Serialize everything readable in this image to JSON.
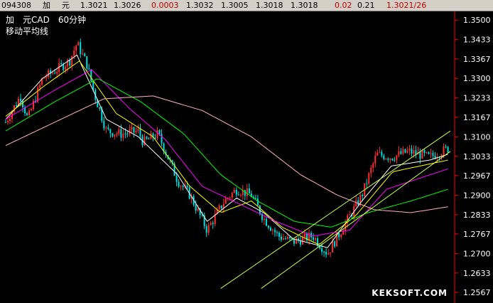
{
  "quote_bar": {
    "code": "094308",
    "name_1": "加",
    "name_2": "元",
    "open": "1.3021",
    "prev": "1.3026",
    "change": "0.0003",
    "high": "1.3032",
    "low": "1.3005",
    "last": "1.3018",
    "last2": "1.3018",
    "pct": "0.02",
    "vol": "0.21",
    "bid_ask": "1.3021/26"
  },
  "header": {
    "symbol_line": "加　元CAD　60分钟",
    "indicator": "移动平均线"
  },
  "watermark": "KEKSOFT.COM",
  "colors": {
    "background": "#000000",
    "axis": "#ff0000",
    "up_candle": "#ff3030",
    "down_candle": "#00e0e0",
    "ma5": "#ffffff",
    "ma10": "#ffff00",
    "ma20": "#ff00ff",
    "ma30": "#00ff00",
    "ma60": "#ffb0c8",
    "channel": "#c8ff50",
    "topbar_bg": "#d4d0c8"
  },
  "chart_data": {
    "type": "line",
    "title": "加　元CAD　60分钟",
    "subtitle": "移动平均线",
    "y_ticks": [
      "1.3500",
      "1.3433",
      "1.3367",
      "1.3300",
      "1.3233",
      "1.3167",
      "1.3100",
      "1.3033",
      "1.2967",
      "1.2900",
      "1.2833",
      "1.2767",
      "1.2700",
      "1.2633",
      "1.2567"
    ],
    "ylim": [
      1.254,
      1.352
    ],
    "x_count": 208,
    "price_path": [
      [
        0,
        1.315
      ],
      [
        12,
        1.324
      ],
      [
        18,
        1.316
      ],
      [
        30,
        1.33
      ],
      [
        38,
        1.332
      ],
      [
        52,
        1.336
      ],
      [
        58,
        1.342
      ],
      [
        66,
        1.335
      ],
      [
        72,
        1.325
      ],
      [
        82,
        1.312
      ],
      [
        94,
        1.311
      ],
      [
        108,
        1.312
      ],
      [
        112,
        1.308
      ],
      [
        124,
        1.311
      ],
      [
        140,
        1.295
      ],
      [
        150,
        1.29
      ],
      [
        164,
        1.278
      ],
      [
        178,
        1.288
      ],
      [
        188,
        1.292
      ],
      [
        200,
        1.29
      ],
      [
        210,
        1.282
      ],
      [
        222,
        1.276
      ],
      [
        234,
        1.274
      ],
      [
        250,
        1.276
      ],
      [
        262,
        1.27
      ],
      [
        272,
        1.277
      ],
      [
        290,
        1.29
      ],
      [
        302,
        1.304
      ],
      [
        314,
        1.303
      ],
      [
        328,
        1.305
      ],
      [
        345,
        1.303
      ],
      [
        360,
        1.306
      ]
    ],
    "moving_averages": [
      {
        "name": "MA5",
        "color": "#ffffff",
        "values": [
          [
            0,
            1.316
          ],
          [
            30,
            1.33
          ],
          [
            58,
            1.338
          ],
          [
            82,
            1.316
          ],
          [
            108,
            1.31
          ],
          [
            140,
            1.297
          ],
          [
            164,
            1.281
          ],
          [
            188,
            1.289
          ],
          [
            210,
            1.284
          ],
          [
            234,
            1.275
          ],
          [
            262,
            1.272
          ],
          [
            290,
            1.288
          ],
          [
            314,
            1.3
          ],
          [
            345,
            1.302
          ],
          [
            360,
            1.304
          ]
        ]
      },
      {
        "name": "MA10",
        "color": "#ffff00",
        "values": [
          [
            0,
            1.317
          ],
          [
            30,
            1.327
          ],
          [
            60,
            1.336
          ],
          [
            90,
            1.318
          ],
          [
            120,
            1.31
          ],
          [
            150,
            1.293
          ],
          [
            175,
            1.284
          ],
          [
            200,
            1.288
          ],
          [
            225,
            1.279
          ],
          [
            255,
            1.273
          ],
          [
            285,
            1.283
          ],
          [
            315,
            1.298
          ],
          [
            360,
            1.302
          ]
        ]
      },
      {
        "name": "MA20",
        "color": "#ff00ff",
        "values": [
          [
            0,
            1.316
          ],
          [
            40,
            1.326
          ],
          [
            70,
            1.333
          ],
          [
            100,
            1.32
          ],
          [
            130,
            1.309
          ],
          [
            160,
            1.293
          ],
          [
            190,
            1.287
          ],
          [
            220,
            1.281
          ],
          [
            250,
            1.276
          ],
          [
            280,
            1.278
          ],
          [
            310,
            1.292
          ],
          [
            360,
            1.299
          ]
        ]
      },
      {
        "name": "MA30",
        "color": "#00ff00",
        "values": [
          [
            0,
            1.312
          ],
          [
            40,
            1.322
          ],
          [
            75,
            1.33
          ],
          [
            110,
            1.322
          ],
          [
            145,
            1.311
          ],
          [
            175,
            1.297
          ],
          [
            205,
            1.288
          ],
          [
            235,
            1.281
          ],
          [
            265,
            1.279
          ],
          [
            295,
            1.284
          ],
          [
            330,
            1.288
          ],
          [
            360,
            1.292
          ]
        ]
      },
      {
        "name": "MA60",
        "color": "#ffb0c8",
        "values": [
          [
            0,
            1.307
          ],
          [
            40,
            1.315
          ],
          [
            80,
            1.323
          ],
          [
            120,
            1.324
          ],
          [
            160,
            1.319
          ],
          [
            200,
            1.31
          ],
          [
            240,
            1.297
          ],
          [
            270,
            1.29
          ],
          [
            300,
            1.285
          ],
          [
            330,
            1.284
          ],
          [
            360,
            1.286
          ]
        ]
      }
    ],
    "channel_lines": [
      {
        "from": [
          175,
          1.258
        ],
        "to": [
          362,
          1.312
        ]
      },
      {
        "from": [
          208,
          1.258
        ],
        "to": [
          362,
          1.305
        ]
      }
    ],
    "grid": false,
    "legend": "none"
  }
}
